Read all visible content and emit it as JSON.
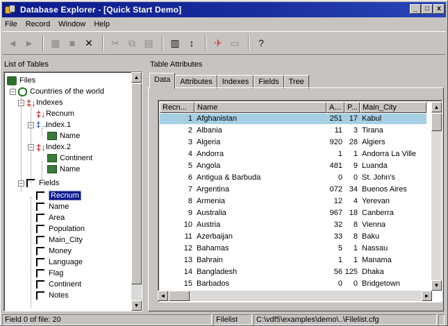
{
  "window": {
    "title": "Database Explorer - [Quick Start Demo]",
    "controls": [
      "_",
      "□",
      "x"
    ]
  },
  "menu": [
    {
      "label": "File"
    },
    {
      "label": "Record"
    },
    {
      "label": "Window"
    },
    {
      "label": "Help"
    }
  ],
  "toolbar": [
    {
      "name": "first-record-icon",
      "glyph": "◄"
    },
    {
      "name": "last-record-icon",
      "glyph": "►"
    },
    {
      "name": "find-icon",
      "glyph": "▦"
    },
    {
      "name": "save-icon",
      "glyph": "■"
    },
    {
      "name": "delete-icon",
      "glyph": "✕"
    },
    {
      "name": "cut-icon",
      "glyph": "✂"
    },
    {
      "name": "copy-icon",
      "glyph": "⧉"
    },
    {
      "name": "paste-icon",
      "glyph": "▤"
    },
    {
      "name": "properties-icon",
      "glyph": "▥"
    },
    {
      "name": "sort-icon",
      "glyph": "↕"
    },
    {
      "name": "tools-icon",
      "glyph": "✈"
    },
    {
      "name": "help-context-icon",
      "glyph": "?"
    }
  ],
  "left_panel": {
    "header": "List of Tables",
    "tree": {
      "files": "Files",
      "table": "Countries of the world",
      "indexes": "Indexes",
      "recnum": "Recnum",
      "index1": "Index.1",
      "index1_field": "Name",
      "index2": "Index.2",
      "index2_field1": "Continent",
      "index2_field2": "Name",
      "fields_label": "Fields",
      "fields": [
        "Recnum",
        "Name",
        "Area",
        "Population",
        "Main_City",
        "Money",
        "Language",
        "Flag",
        "Continent",
        "Notes"
      ]
    }
  },
  "right_panel": {
    "header": "Table Attributes",
    "tabs": [
      "Data",
      "Attributes",
      "Indexes",
      "Fields",
      "Tree"
    ],
    "columns": [
      "Recn...",
      "Name",
      "A...",
      "P...",
      "Main_City"
    ],
    "rows": [
      [
        "1",
        "Afghanistan",
        "251",
        "17",
        "Kabul"
      ],
      [
        "2",
        "Albania",
        "11",
        "3",
        "Tirana"
      ],
      [
        "3",
        "Algeria",
        "920",
        "28",
        "Algiers"
      ],
      [
        "4",
        "Andorra",
        "1",
        "1",
        "Andorra La Ville"
      ],
      [
        "5",
        "Angola",
        "481",
        "9",
        "Luanda"
      ],
      [
        "6",
        "Antigua & Barbuda",
        "0",
        "0",
        "St. John's"
      ],
      [
        "7",
        "Argentina",
        "072",
        "34",
        "Buenos Aires"
      ],
      [
        "8",
        "Armenia",
        "12",
        "4",
        "Yerevan"
      ],
      [
        "9",
        "Australia",
        "967",
        "18",
        "Canberra"
      ],
      [
        "10",
        "Austria",
        "32",
        "8",
        "Vienna"
      ],
      [
        "11",
        "Azerbaijan",
        "33",
        "8",
        "Baku"
      ],
      [
        "12",
        "Bahamas",
        "5",
        "1",
        "Nassau"
      ],
      [
        "13",
        "Bahrain",
        "1",
        "1",
        "Manama"
      ],
      [
        "14",
        "Bangladesh",
        "56",
        "125",
        "Dhaka"
      ],
      [
        "15",
        "Barbados",
        "0",
        "0",
        "Bridgetown"
      ]
    ],
    "selected_row": 0
  },
  "status": {
    "field": "Field 0 of file: 20",
    "filelist_label": "Filelist",
    "path": "C:\\vdf5\\examples\\demo\\..\\Filelist.cfg"
  }
}
